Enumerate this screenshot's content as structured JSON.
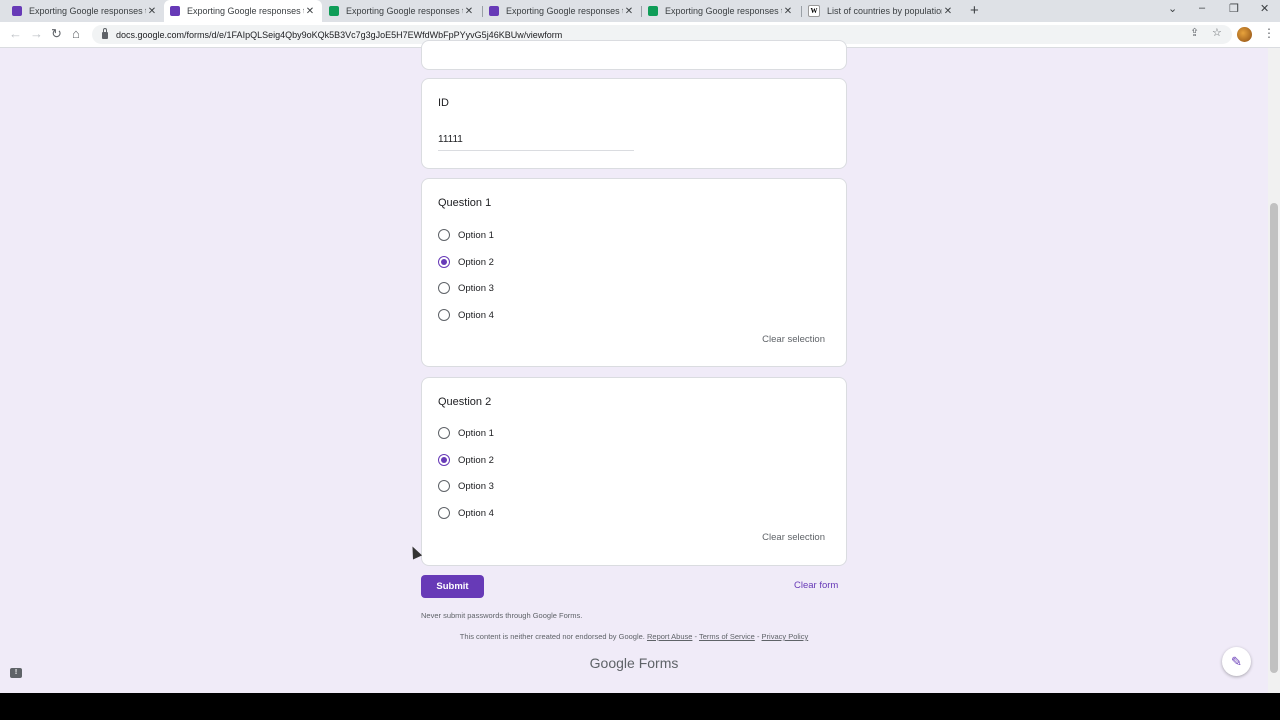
{
  "browser": {
    "tabs": [
      {
        "title": "Exporting Google responses to E",
        "icon": "forms-icon",
        "active": false
      },
      {
        "title": "Exporting Google responses to E",
        "icon": "forms-icon",
        "active": true
      },
      {
        "title": "Exporting Google responses to E",
        "icon": "sheets-icon",
        "active": false
      },
      {
        "title": "Exporting Google responses to E",
        "icon": "forms-icon",
        "active": false
      },
      {
        "title": "Exporting Google responses to E",
        "icon": "sheets-icon",
        "active": false
      },
      {
        "title": "List of countries by population in",
        "icon": "wikipedia-icon",
        "active": false
      }
    ],
    "url": "docs.google.com/forms/d/e/1FAIpQLSeig4Qby9oKQk5B3Vc7g3gJoE5H7EWfdWbFpPYyvG5j46KBUw/viewform"
  },
  "form": {
    "id_question": {
      "title": "ID",
      "value": "11111"
    },
    "questions": [
      {
        "title": "Question 1",
        "options": [
          "Option 1",
          "Option 2",
          "Option 3",
          "Option 4"
        ],
        "selected": "Option 2",
        "clear_label": "Clear selection"
      },
      {
        "title": "Question 2",
        "options": [
          "Option 1",
          "Option 2",
          "Option 3",
          "Option 4"
        ],
        "selected": "Option 2",
        "clear_label": "Clear selection"
      }
    ],
    "submit_label": "Submit",
    "clear_form_label": "Clear form",
    "password_warning": "Never submit passwords through Google Forms.",
    "footer": {
      "disclaimer": "This content is neither created nor endorsed by Google.",
      "report_abuse": "Report Abuse",
      "terms": "Terms of Service",
      "privacy": "Privacy Policy",
      "separator": "-"
    },
    "brand": {
      "google": "Google",
      "forms": "Forms"
    }
  },
  "colors": {
    "accent": "#673ab7",
    "background": "#f0ebf8"
  }
}
